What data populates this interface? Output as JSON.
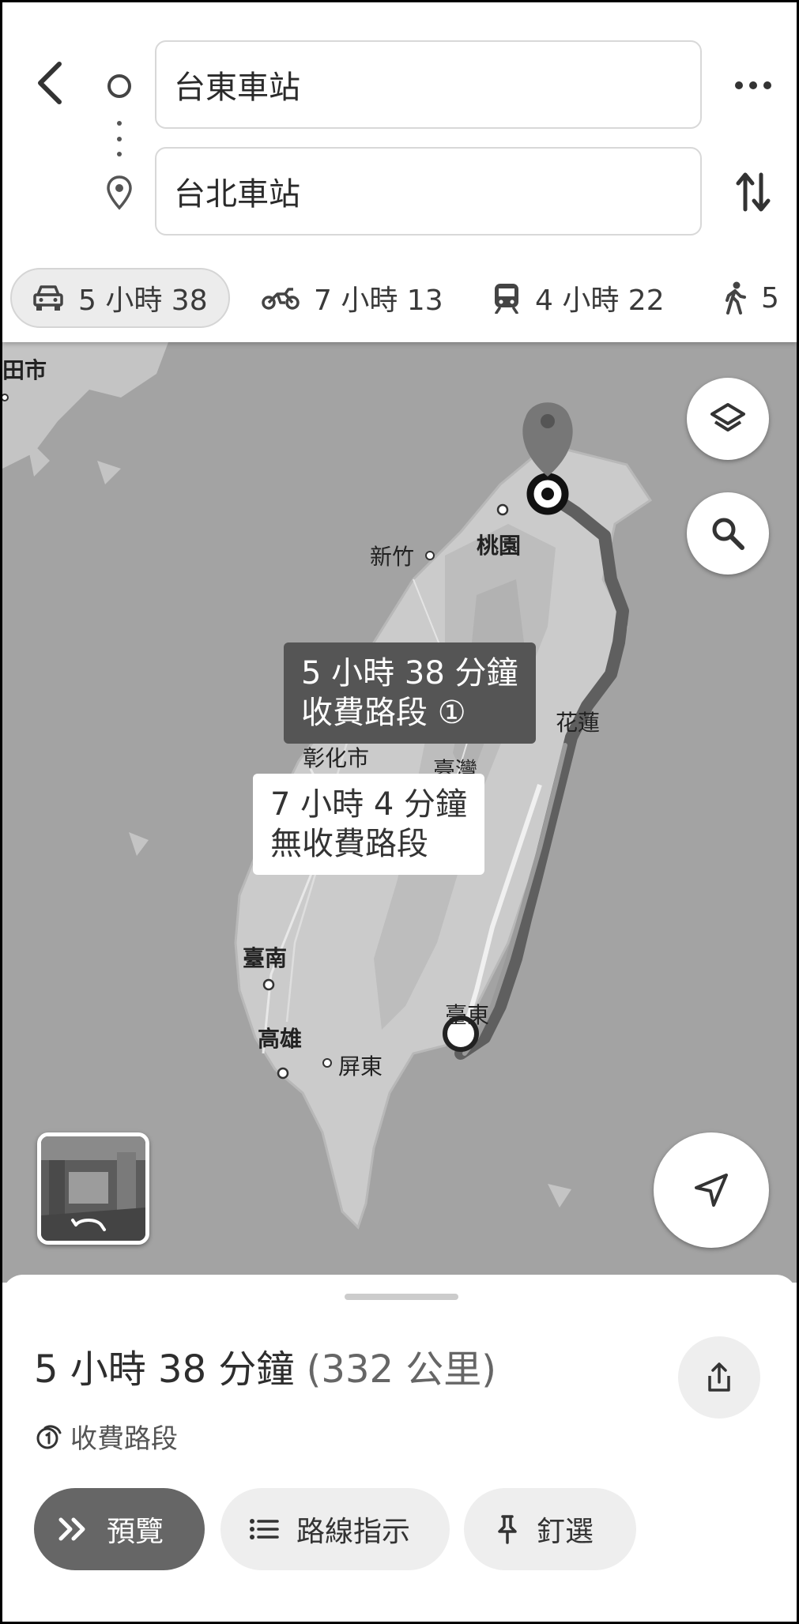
{
  "search": {
    "origin": "台東車站",
    "destination": "台北車站"
  },
  "modes": [
    {
      "icon": "car-icon",
      "label": "5 小時 38"
    },
    {
      "icon": "motorcycle-icon",
      "label": "7 小時 13"
    },
    {
      "icon": "train-icon",
      "label": "4 小時 22"
    },
    {
      "icon": "walk-icon",
      "label": "5"
    }
  ],
  "map": {
    "labels": {
      "corner": "田市",
      "taoyuan": "桃園",
      "hsinchu": "新竹",
      "hualien": "花蓮",
      "changhua": "彰化市",
      "taiwan": "臺灣",
      "tainan": "臺南",
      "kaohsiung": "高雄",
      "pingtung": "屏東",
      "taitung": "臺東"
    },
    "routes": {
      "primary": {
        "line1": "5 小時 38 分鐘",
        "line2": "收費路段",
        "badge": "①"
      },
      "alternate": {
        "line1": "7 小時 4 分鐘",
        "line2": "無收費路段"
      }
    }
  },
  "sheet": {
    "duration": "5 小時 38 分鐘",
    "distance": "(332 公里)",
    "toll_note": "收費路段",
    "buttons": {
      "preview": "預覽",
      "steps": "路線指示",
      "pin": "釘選"
    }
  },
  "colors": {
    "route_primary": "#5f5f5f",
    "route_alternate": "#9a9a9a",
    "map_sea": "#a3a3a3",
    "map_land": "#cbcbcb",
    "pin": "#777777"
  }
}
